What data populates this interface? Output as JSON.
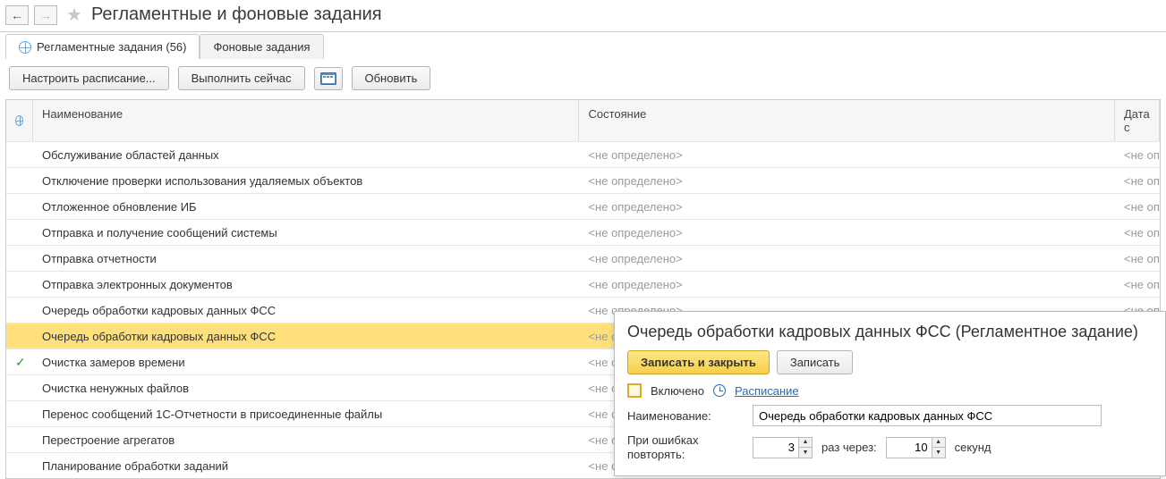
{
  "header": {
    "title": "Регламентные и фоновые задания"
  },
  "tabs": {
    "scheduled": "Регламентные задания (56)",
    "background": "Фоновые задания"
  },
  "toolbar": {
    "configure": "Настроить расписание...",
    "run_now": "Выполнить сейчас",
    "refresh": "Обновить"
  },
  "table": {
    "head": {
      "name": "Наименование",
      "state": "Состояние",
      "date": "Дата с"
    },
    "rows": [
      {
        "status": "",
        "name": "Обслуживание областей данных",
        "state": "<не определено>",
        "date": "<не оп",
        "selected": false
      },
      {
        "status": "",
        "name": "Отключение проверки использования удаляемых объектов",
        "state": "<не определено>",
        "date": "<не оп",
        "selected": false
      },
      {
        "status": "",
        "name": "Отложенное обновление ИБ",
        "state": "<не определено>",
        "date": "<не оп",
        "selected": false
      },
      {
        "status": "",
        "name": "Отправка и получение сообщений системы",
        "state": "<не определено>",
        "date": "<не оп",
        "selected": false
      },
      {
        "status": "",
        "name": "Отправка отчетности",
        "state": "<не определено>",
        "date": "<не оп",
        "selected": false
      },
      {
        "status": "",
        "name": "Отправка электронных документов",
        "state": "<не определено>",
        "date": "<не оп",
        "selected": false
      },
      {
        "status": "",
        "name": "Очередь обработки кадровых данных ФСС",
        "state": "<не определено>",
        "date": "<не оп",
        "selected": false
      },
      {
        "status": "",
        "name": "Очередь обработки кадровых данных ФСС",
        "state": "<не определено>",
        "date": "<не оп",
        "selected": true
      },
      {
        "status": "✓",
        "name": "Очистка замеров времени",
        "state": "<не определено>",
        "date": "<не оп",
        "selected": false
      },
      {
        "status": "",
        "name": "Очистка ненужных файлов",
        "state": "<не определено>",
        "date": "<не оп",
        "selected": false
      },
      {
        "status": "",
        "name": "Перенос сообщений 1С-Отчетности в присоединенные файлы",
        "state": "<не определено>",
        "date": "<не оп",
        "selected": false
      },
      {
        "status": "",
        "name": "Перестроение агрегатов",
        "state": "<не определено>",
        "date": "<не оп",
        "selected": false
      },
      {
        "status": "",
        "name": "Планирование обработки заданий",
        "state": "<не определено>",
        "date": "<не оп",
        "selected": false
      }
    ]
  },
  "panel": {
    "title": "Очередь обработки кадровых данных ФСС (Регламентное задание)",
    "save_close": "Записать и закрыть",
    "save": "Записать",
    "enabled_label": "Включено",
    "schedule_link": "Расписание",
    "name_label": "Наименование:",
    "name_value": "Очередь обработки кадровых данных ФСС",
    "retry_label": "При ошибках повторять:",
    "retry_count": "3",
    "times_after": "раз  через:",
    "retry_delay": "10",
    "seconds": "секунд"
  }
}
